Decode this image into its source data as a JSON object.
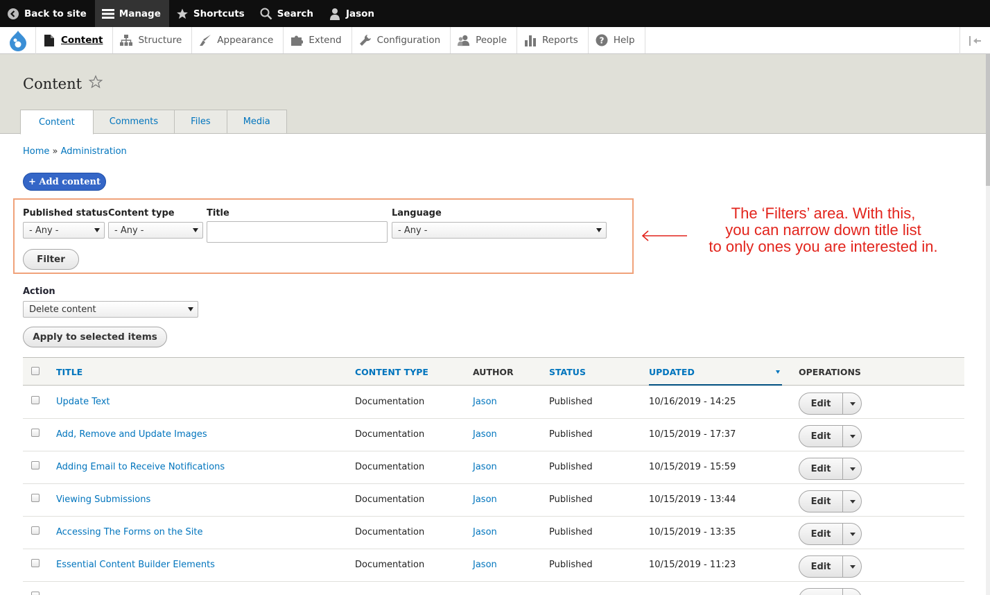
{
  "toolbar": {
    "back_label": "Back to site",
    "manage_label": "Manage",
    "shortcuts_label": "Shortcuts",
    "search_label": "Search",
    "user_label": "Jason"
  },
  "tray": {
    "items": [
      {
        "label": "Content",
        "icon": "page-icon"
      },
      {
        "label": "Structure",
        "icon": "sitemap-icon"
      },
      {
        "label": "Appearance",
        "icon": "paintbrush-icon"
      },
      {
        "label": "Extend",
        "icon": "puzzle-icon"
      },
      {
        "label": "Configuration",
        "icon": "wrench-icon"
      },
      {
        "label": "People",
        "icon": "people-icon"
      },
      {
        "label": "Reports",
        "icon": "bar-chart-icon"
      },
      {
        "label": "Help",
        "icon": "help-icon"
      }
    ]
  },
  "header": {
    "title": "Content",
    "tabs": [
      {
        "label": "Content"
      },
      {
        "label": "Comments"
      },
      {
        "label": "Files"
      },
      {
        "label": "Media"
      }
    ]
  },
  "breadcrumb": {
    "home": "Home",
    "separator": "»",
    "admin": "Administration"
  },
  "add_content_label": "+ Add content",
  "filters": {
    "published_status_label": "Published status",
    "published_status_value": "- Any -",
    "content_type_label": "Content type",
    "content_type_value": "- Any -",
    "title_label": "Title",
    "title_value": "",
    "language_label": "Language",
    "language_value": "- Any -",
    "filter_button": "Filter"
  },
  "annotation": {
    "line1": "The ‘Filters’ area. With this,",
    "line2": "you can narrow down title list",
    "line3": "to only ones you are interested in.",
    "color": "#e2241c"
  },
  "action": {
    "label": "Action",
    "value": "Delete content",
    "apply_button": "Apply to selected items"
  },
  "table": {
    "headers": {
      "title": "TITLE",
      "content_type": "CONTENT TYPE",
      "author": "AUTHOR",
      "status": "STATUS",
      "updated": "UPDATED",
      "operations": "OPERATIONS"
    },
    "rows": [
      {
        "title": "Update Text",
        "type": "Documentation",
        "author": "Jason",
        "status": "Published",
        "updated": "10/16/2019 - 14:25",
        "op": "Edit"
      },
      {
        "title": "Add, Remove and Update Images",
        "type": "Documentation",
        "author": "Jason",
        "status": "Published",
        "updated": "10/15/2019 - 17:37",
        "op": "Edit"
      },
      {
        "title": "Adding Email to Receive Notifications",
        "type": "Documentation",
        "author": "Jason",
        "status": "Published",
        "updated": "10/15/2019 - 15:59",
        "op": "Edit"
      },
      {
        "title": "Viewing Submissions",
        "type": "Documentation",
        "author": "Jason",
        "status": "Published",
        "updated": "10/15/2019 - 13:44",
        "op": "Edit"
      },
      {
        "title": "Accessing The Forms on the Site",
        "type": "Documentation",
        "author": "Jason",
        "status": "Published",
        "updated": "10/15/2019 - 13:35",
        "op": "Edit"
      },
      {
        "title": "Essential Content Builder Elements",
        "type": "Documentation",
        "author": "Jason",
        "status": "Published",
        "updated": "10/15/2019 - 11:23",
        "op": "Edit"
      }
    ]
  },
  "colors": {
    "link": "#0074bd",
    "primary_button": "#3466c7",
    "filter_border": "#f0a27a",
    "toolbar_bg": "#0f0f0f"
  }
}
